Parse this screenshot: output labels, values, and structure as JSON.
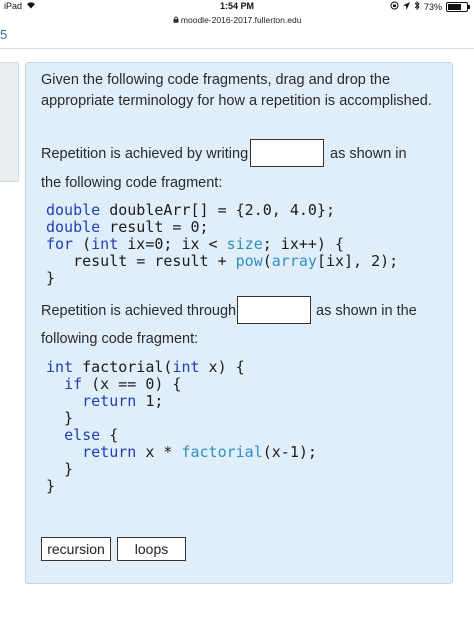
{
  "status_bar": {
    "device": "iPad",
    "time": "1:54 PM",
    "battery": "73%"
  },
  "url": "moodle-2016-2017.fullerton.edu",
  "page_number": "5",
  "question": {
    "prompt": "Given the following code fragments, drag and drop the appropriate terminology for how a repetition is accomplished.",
    "sentence1_before": "Repetition is achieved by writing",
    "sentence1_after": "as shown in",
    "sentence1_cont": "the following code fragment:",
    "sentence2_before": "Repetition is achieved through",
    "sentence2_after": "as shown in the",
    "sentence2_cont": "following code fragment:",
    "choices": [
      "recursion",
      "loops"
    ]
  },
  "code1": {
    "line1_type": "double",
    "line1_rest": " doubleArr[] = {2.0, 4.0};",
    "line2_type": "double",
    "line2_rest": " result = 0;",
    "line3_kw": "for",
    "line3_a": " (",
    "line3_int": "int",
    "line3_b": " ix=0; ix < ",
    "line3_size": "size",
    "line3_c": "; ix++) {",
    "line4_a": "   result = result + ",
    "line4_pow": "pow",
    "line4_b": "(",
    "line4_array": "array",
    "line4_c": "[ix], 2);",
    "line5": "}"
  },
  "code2": {
    "line1_int": "int",
    "line1_a": " factorial(",
    "line1_int2": "int",
    "line1_b": " x) {",
    "line2_pre": "  ",
    "line2_if": "if",
    "line2_rest": " (x == 0) {",
    "line3_pre": "    ",
    "line3_ret": "return",
    "line3_rest": " 1;",
    "line4": "  }",
    "line5_pre": "  ",
    "line5_else": "else",
    "line5_rest": " {",
    "line6_pre": "    ",
    "line6_ret": "return",
    "line6_a": " x * ",
    "line6_fn": "factorial",
    "line6_b": "(x-1);",
    "line7": "  }",
    "line8": "}"
  }
}
